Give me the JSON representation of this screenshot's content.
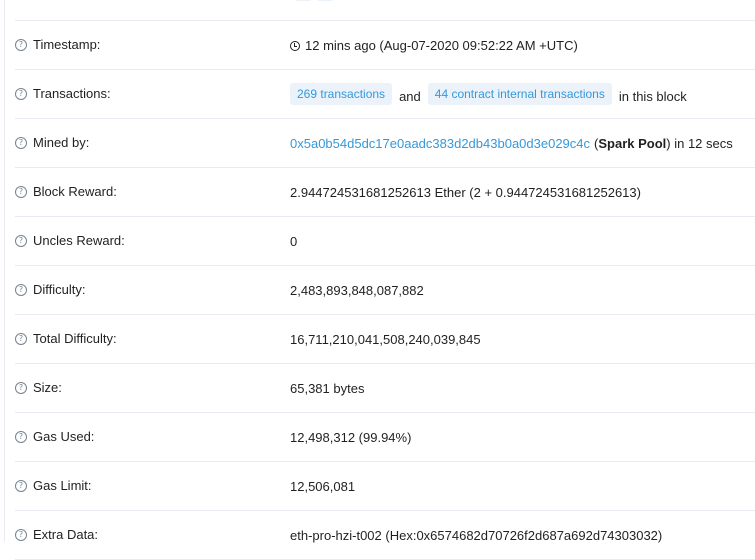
{
  "rows": [
    {
      "label": "",
      "value": ""
    },
    {
      "label": "Timestamp:",
      "value": "12 mins ago (Aug-07-2020 09:52:22 AM +UTC)"
    },
    {
      "label": "Transactions:",
      "tx_badge": "269 transactions",
      "and": "and",
      "internal_badge": "44 contract internal transactions",
      "suffix": "in this block"
    },
    {
      "label": "Mined by:",
      "address": "0x5a0b54d5dc17e0aadc383d2db43b0a0d3e029c4c",
      "pool_open": "(",
      "pool": "Spark Pool",
      "pool_close": ") in 12 secs"
    },
    {
      "label": "Block Reward:",
      "value": "2.944724531681252613 Ether (2 + 0.944724531681252613)"
    },
    {
      "label": "Uncles Reward:",
      "value": "0"
    },
    {
      "label": "Difficulty:",
      "value": "2,483,893,848,087,882"
    },
    {
      "label": "Total Difficulty:",
      "value": "16,711,210,041,508,240,039,845"
    },
    {
      "label": "Size:",
      "value": "65,381 bytes"
    },
    {
      "label": "Gas Used:",
      "value": "12,498,312 (99.94%)"
    },
    {
      "label": "Gas Limit:",
      "value": "12,506,081"
    },
    {
      "label": "Extra Data:",
      "value": "eth-pro-hzi-t002 (Hex:0x6574682d70726f2d687a692d74303032)"
    }
  ],
  "icons": {
    "help": "question-circle-icon",
    "clock": "clock-icon"
  },
  "colors": {
    "link": "#3498db",
    "badge_bg": "#ecf2fa",
    "border": "#e7eaf3",
    "text": "#1e2022"
  }
}
